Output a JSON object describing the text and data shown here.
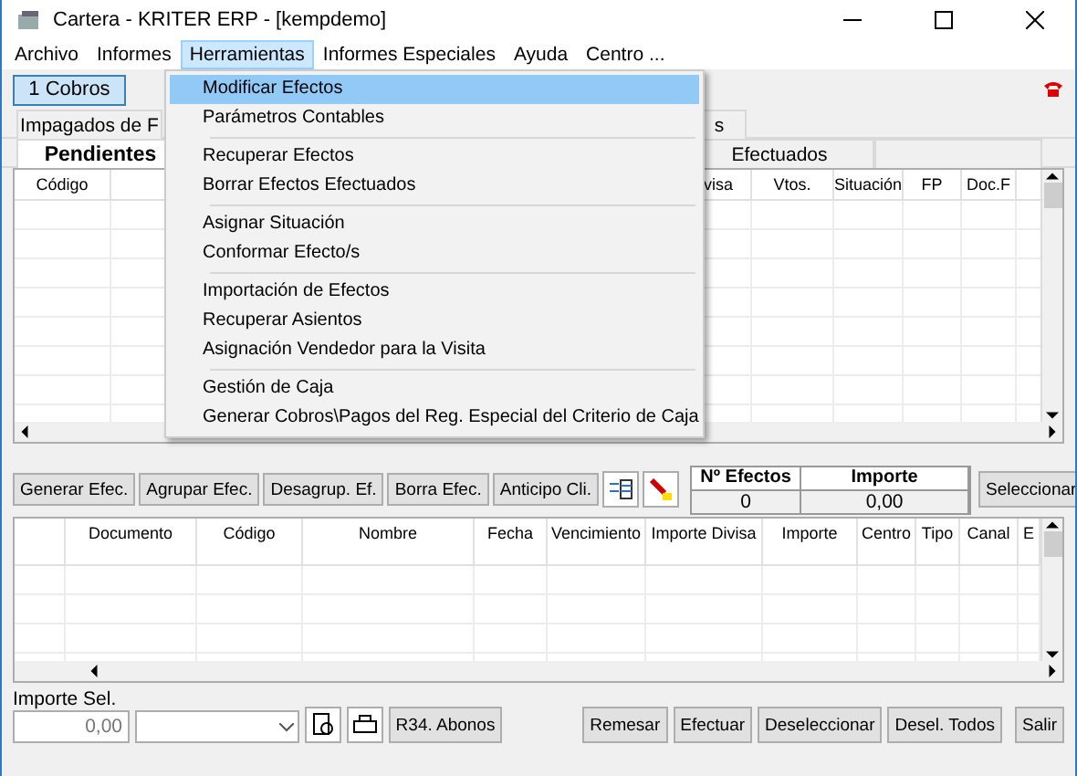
{
  "window": {
    "title": "Cartera - KRITER ERP - [kempdemo]"
  },
  "menu_bar": [
    {
      "label": "Archivo",
      "selected": false
    },
    {
      "label": "Informes",
      "selected": false
    },
    {
      "label": "Herramientas",
      "selected": true
    },
    {
      "label": "Informes Especiales",
      "selected": false
    },
    {
      "label": "Ayuda",
      "selected": false
    },
    {
      "label": "Centro ...",
      "selected": false
    }
  ],
  "dropdown_menu": {
    "groups": [
      [
        {
          "label": "Modificar Efectos",
          "selected": true
        },
        {
          "label": "Parámetros Contables",
          "selected": false
        }
      ],
      [
        {
          "label": "Recuperar Efectos",
          "selected": false
        },
        {
          "label": "Borrar Efectos Efectuados",
          "selected": false
        }
      ],
      [
        {
          "label": "Asignar Situación",
          "selected": false
        },
        {
          "label": "Conformar Efecto/s",
          "selected": false
        }
      ],
      [
        {
          "label": "Importación de Efectos",
          "selected": false
        },
        {
          "label": "Recuperar Asientos",
          "selected": false
        },
        {
          "label": "Asignación Vendedor para la Visita",
          "selected": false
        }
      ],
      [
        {
          "label": "Gestión de Caja",
          "selected": false
        },
        {
          "label": "Generar Cobros\\Pagos del Reg. Especial del Criterio de Caja",
          "selected": false
        }
      ]
    ]
  },
  "toolbar": [
    {
      "label": "1 Cobros",
      "selected": true
    }
  ],
  "outer_tabs": [
    {
      "label": "Impagados de F",
      "selected": false
    },
    {
      "label": "s",
      "selected": false
    }
  ],
  "inner_tabs": [
    {
      "label": "Pendientes",
      "selected": true
    },
    {
      "label": "Efectuados",
      "selected": false
    }
  ],
  "upper_grid": {
    "columns": [
      "Código",
      "visa",
      "Vtos.",
      "Situación",
      "FP",
      "Doc.F"
    ]
  },
  "action_buttons": [
    "Generar Efec.",
    "Agrupar Efec.",
    "Desagrup. Ef.",
    "Borra Efec.",
    "Anticipo Cli."
  ],
  "summary": {
    "columns": [
      "Nº Efectos",
      "Importe"
    ],
    "values": [
      "0",
      "0,00"
    ]
  },
  "select_button": "Seleccionar",
  "lower_grid": {
    "columns": [
      "Documento",
      "Código",
      "Nombre",
      "Fecha",
      "Vencimiento",
      "Importe Divisa",
      "Importe",
      "Centro",
      "Tipo",
      "Canal",
      "E"
    ]
  },
  "bottom": {
    "label": "Importe Sel.",
    "value": "0,00",
    "left_buttons": [
      "R34. Abonos"
    ],
    "right_buttons": [
      "Remesar",
      "Efectuar",
      "Deseleccionar",
      "Desel. Todos",
      "Salir"
    ]
  }
}
